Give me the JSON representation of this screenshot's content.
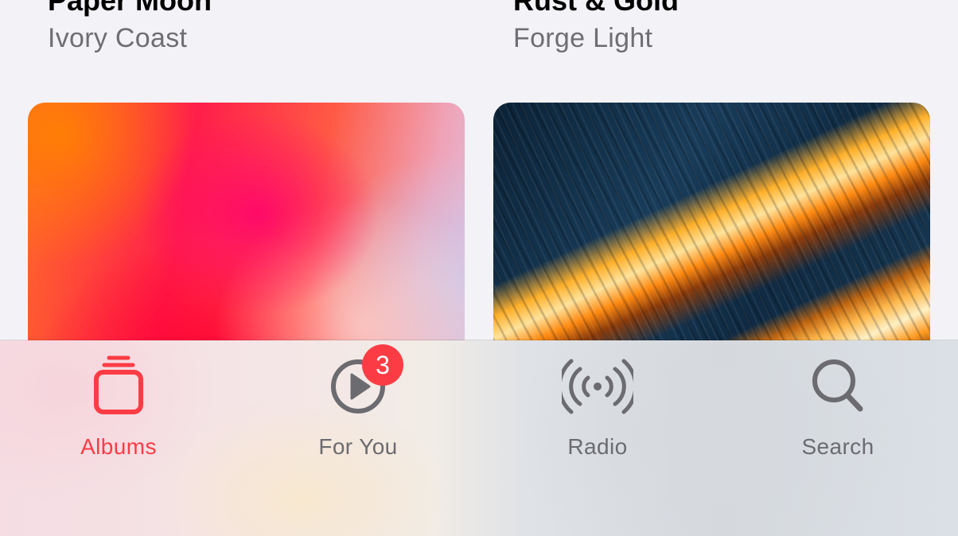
{
  "colors": {
    "accent": "#fc3c44",
    "inactive": "#6b6b70",
    "background": "#f2f2f7"
  },
  "albums": [
    {
      "title": "Paper Moon",
      "artist": "Ivory Coast"
    },
    {
      "title": "Rust & Gold",
      "artist": "Forge Light"
    }
  ],
  "tabbar": {
    "tabs": [
      {
        "label": "Albums",
        "icon": "albums-stack-icon",
        "selected": true
      },
      {
        "label": "For You",
        "icon": "play-circle-icon",
        "selected": false,
        "badge": "3"
      },
      {
        "label": "Radio",
        "icon": "radio-broadcast-icon",
        "selected": false
      },
      {
        "label": "Search",
        "icon": "magnifying-glass-icon",
        "selected": false
      }
    ]
  }
}
